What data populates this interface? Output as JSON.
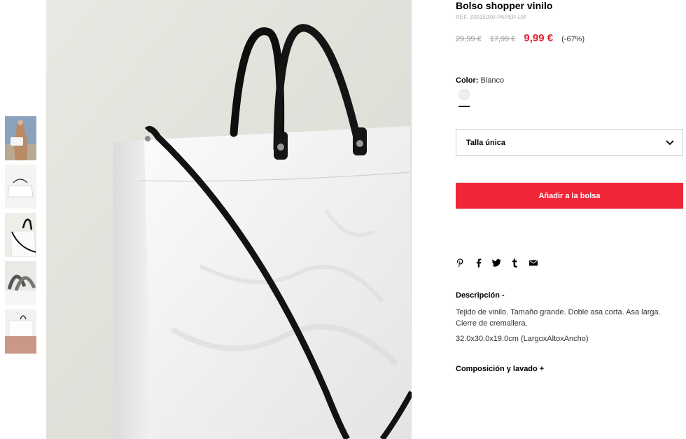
{
  "product": {
    "title": "Bolso shopper vinilo",
    "reference": "REF. 33015030-PAPER-LM",
    "original_price": "29,99 €",
    "previous_price": "17,99 €",
    "current_price": "9,99 €",
    "discount": "(-67%)"
  },
  "color": {
    "label": "Color:",
    "value": "Blanco",
    "swatch_hex": "#efefe9"
  },
  "size": {
    "selected": "Talla única"
  },
  "add_to_bag": {
    "label": "Añadir a la bolsa",
    "color": "#f02638"
  },
  "share": {
    "icons": [
      "pinterest-icon",
      "facebook-icon",
      "twitter-icon",
      "tumblr-icon",
      "mail-icon"
    ]
  },
  "description": {
    "title": "Descripción -",
    "text": "Tejido de vinilo. Tamaño grande. Doble asa corta. Asa larga. Cierre de cremallera.",
    "dimensions": "32.0x30.0x19.0cm (LargoxAltoxAncho)"
  },
  "composition": {
    "title": "Composición y lavado +"
  },
  "gallery": {
    "thumbnail_count": 5,
    "accent_price_color": "#e5202e"
  }
}
